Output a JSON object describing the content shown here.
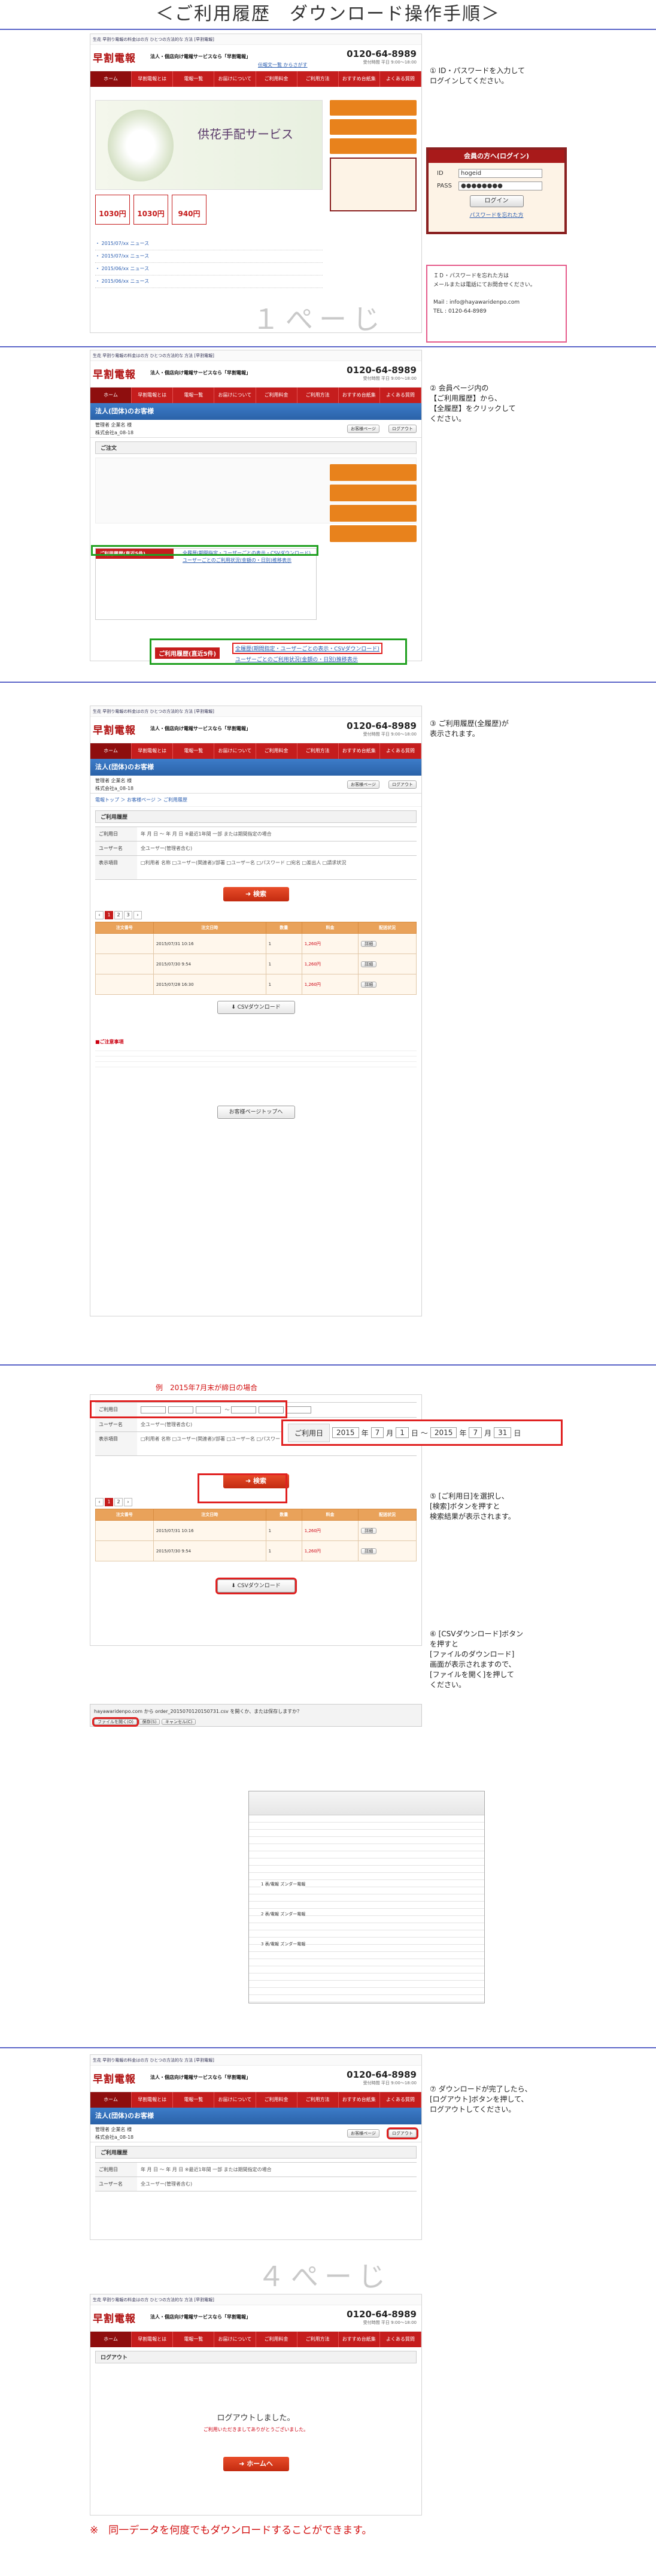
{
  "title": "＜ご利用履歴　ダウンロード操作手順＞",
  "site": {
    "topbar": "生花 早割り電報の料金はの方 ひとつの方法的な 方法 [早割電報]",
    "logo": "早割電報",
    "tagline": "法人・個店向け電報サービスなら「早割電報」",
    "header_link": "伝報文一覧 からさがす",
    "phone": "0120-64-8989",
    "phone_sub": "受付時間 平日 9:00〜18:00",
    "nav": [
      "ホーム",
      "早割電報とは",
      "電報一覧",
      "お届けについて",
      "ご利用料金",
      "ご利用方法",
      "おすすめ台紙集",
      "よくある質問"
    ]
  },
  "step1": {
    "instruction": "① ID・パスワードを入力して\nログインしてください。",
    "banner_title": "供花手配サービス",
    "prices": [
      "1030円",
      "1030円",
      "940円"
    ],
    "login": {
      "title": "会員の方へ(ログイン)",
      "id_label": "ID",
      "id_value": "hogeid",
      "pass_label": "PASS",
      "pass_value": "●●●●●●●●",
      "button": "ログイン",
      "forgot": "パスワードを忘れた方"
    },
    "notice": "ＩＤ・パスワードを忘れた方は\nメールまたは電話にてお問合せください。",
    "contact": "Mail : info@hayawaridenpo.com\nTEL : 0120-64-8989",
    "page_label": "１ぺーじ"
  },
  "step2": {
    "instruction": "② 会員ページ内の\n【ご利用履歴】から、\n【全履歴】をクリックして\nください。",
    "company": "法人(団体)のお客様",
    "member_line1": "管理者 企業名 様",
    "member_line2": "株式会社a_08-18",
    "buttons": [
      "お客様ページ",
      "ログアウト"
    ],
    "section": "ご注文",
    "history_label": "ご利用履歴(直近5件)",
    "link_all": "全履歴(期間指定・ユーザーごとの表示・CSVダウンロード)",
    "link_sub": "ユーザーごとのご利用状況(金額の・日別)推移表示"
  },
  "step3": {
    "instruction": "③ ご利用履歴(全履歴)が\n表示されます。",
    "crumb": "電報トップ ＞ お客様ページ ＞ ご利用履歴",
    "box": "ご利用履歴",
    "form": [
      {
        "label": "ご利用日",
        "value": "年 月 日 ～ 年 月 日  ※最近1年間 一部 または期間指定の場合"
      },
      {
        "label": "ユーザー名",
        "value": "全ユーザー(管理者含む)"
      },
      {
        "label": "表示項目",
        "value": "□利用者 名称 □ユーザー(関連者)/部署 □ユーザー名 □パスワード □宛名 □差出人 □請求状況"
      }
    ],
    "search": "検索",
    "table_head": [
      "注文番号",
      "注文日時",
      "数量",
      "料金",
      "配送状況"
    ],
    "rows": [
      {
        "no": "",
        "date": "2015/07/31 10:16",
        "qty": "1",
        "price": "1,260円",
        "status": "詳細"
      },
      {
        "no": "",
        "date": "2015/07/30 9:54",
        "qty": "1",
        "price": "1,260円",
        "status": "詳細"
      },
      {
        "no": "",
        "date": "2015/07/28 16:30",
        "qty": "1",
        "price": "1,260円",
        "status": "詳細"
      }
    ],
    "csv": "CSVダウンロード",
    "back": "お客様ページトップへ",
    "note_title": "■ご注意事項"
  },
  "step4": {
    "instruction_5": "⑤ [ご利用日]を選択し、\n[検索]ボタンを押すと\n検索結果が表示されます。",
    "instruction_6": "⑥ [CSVダウンロード]ボタン\nを押すと\n[ファイルのダウンロード]\n画面が表示されますので、\n[ファイルを開く]を押して\nください。",
    "note": "例　2015年7月末が締日の場合",
    "date_label": "ご利用日",
    "dates": {
      "y1": "2015",
      "m1": "7",
      "d1": "1",
      "y2": "2015",
      "m2": "7",
      "d2": "31"
    },
    "units": [
      "年",
      "月",
      "日",
      "～",
      "年",
      "月",
      "日"
    ],
    "search": "検索",
    "csv": "CSVダウンロード",
    "download_bar": "hayawaridenpo.com から order_2015070120150731.csv を開くか、または保存しますか？",
    "open_file": "ファイルを開く(O)",
    "save_file": "保存(S)",
    "cancel": "キャンセル(C)",
    "sheet_rows": [
      "1 表/電報 ズンダー電報",
      "2 表/電報 ズンダー電報",
      "3 表/電報 ズンダー電報"
    ]
  },
  "step5": {
    "instruction": "⑦ ダウンロードが完了したら、\n[ログアウト]ボタンを押して、\nログアウトしてください。",
    "page_label": "４ぺーじ",
    "logout_crumb": "ログアウト",
    "logout_msg": "ログアウトしました。",
    "logout_sub": "ご利用いただきましてありがとうございました。",
    "home": "ホームへ"
  },
  "footer": "※　同一データを何度でもダウンロードすることができます。"
}
